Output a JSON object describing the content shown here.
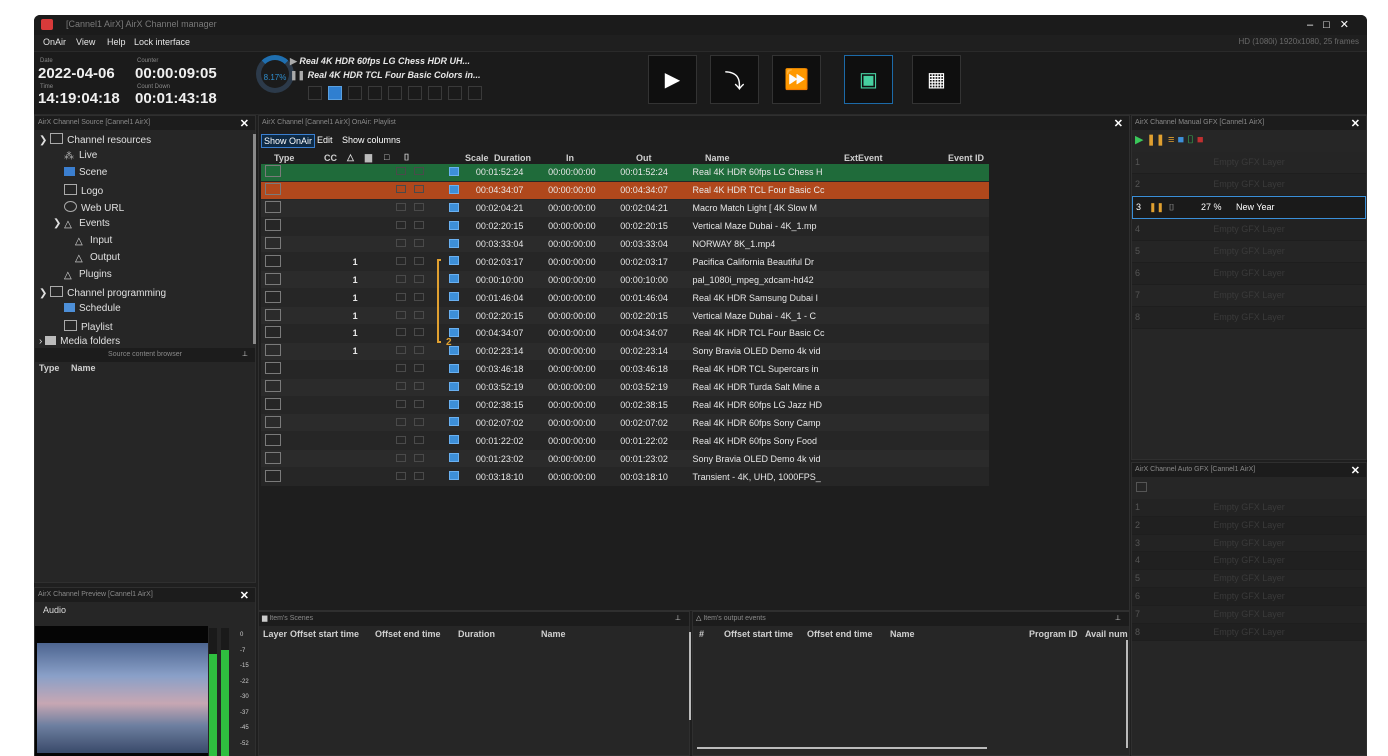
{
  "window": {
    "title": "[Cannel1 AirX] AirX Channel manager",
    "resolution": "HD (1080i) 1920x1080, 25 frames"
  },
  "menu": [
    "OnAir",
    "View",
    "Help",
    "Lock interface"
  ],
  "toolbar": {
    "date_label": "Date",
    "date": "2022-04-06",
    "counter_label": "Counter",
    "counter": "00:00:09:05",
    "time_label": "Time",
    "time": "14:19:04:18",
    "countdown_label": "Count Down",
    "countdown": "00:01:43:18",
    "progress_label": "8.17%",
    "progress": 8.17,
    "now_playing": "Real 4K HDR 60fps  LG Chess HDR UH...",
    "next_playing": "Real 4K HDR  TCL Four Basic Colors in..."
  },
  "source_panel": {
    "title": "AirX Channel Source [Cannel1 AirX]",
    "tree": [
      "Channel resources",
      "Live",
      "Scene",
      "Logo",
      "Web URL",
      "Events",
      "Input",
      "Output",
      "Plugins",
      "Channel programming",
      "Schedule",
      "Playlist",
      "Media folders"
    ],
    "browser_title": "Source content browser",
    "browser_cols": [
      "Type",
      "Name"
    ]
  },
  "preview_panel": {
    "title": "AirX Channel Preview [Cannel1 AirX]",
    "audio_label": "Audio",
    "meter_scale": [
      "0",
      "-7",
      "-15",
      "-22",
      "-30",
      "-37",
      "-45",
      "-52"
    ]
  },
  "playlist": {
    "title": "AirX Channel [Cannel1 AirX] OnAir: Playlist",
    "tabs": [
      "Show OnAir",
      "Edit",
      "Show columns"
    ],
    "headers": [
      "Type",
      "CC",
      "Scale",
      "Duration",
      "In",
      "Out",
      "Name",
      "ExtEvent",
      "Event ID"
    ],
    "rows": [
      {
        "num": "",
        "duration": "00:01:52:24",
        "in": "00:00:00:00",
        "out": "00:01:52:24",
        "name": "Real 4K HDR 60fps  LG Chess H"
      },
      {
        "num": "",
        "duration": "00:04:34:07",
        "in": "00:00:00:00",
        "out": "00:04:34:07",
        "name": "Real 4K HDR  TCL Four Basic Cc"
      },
      {
        "num": "",
        "duration": "00:02:04:21",
        "in": "00:00:00:00",
        "out": "00:02:04:21",
        "name": "Macro Match Light [ 4K Slow M"
      },
      {
        "num": "",
        "duration": "00:02:20:15",
        "in": "00:00:00:00",
        "out": "00:02:20:15",
        "name": "Vertical Maze Dubai - 4K_1.mp"
      },
      {
        "num": "",
        "duration": "00:03:33:04",
        "in": "00:00:00:00",
        "out": "00:03:33:04",
        "name": "NORWAY 8K_1.mp4"
      },
      {
        "num": "1",
        "duration": "00:02:03:17",
        "in": "00:00:00:00",
        "out": "00:02:03:17",
        "name": "Pacifica California Beautiful Dr"
      },
      {
        "num": "1",
        "duration": "00:00:10:00",
        "in": "00:00:00:00",
        "out": "00:00:10:00",
        "name": "pal_1080i_mpeg_xdcam-hd42"
      },
      {
        "num": "1",
        "duration": "00:01:46:04",
        "in": "00:00:00:00",
        "out": "00:01:46:04",
        "name": "Real 4K HDR  Samsung Dubai I"
      },
      {
        "num": "1",
        "duration": "00:02:20:15",
        "in": "00:00:00:00",
        "out": "00:02:20:15",
        "name": "Vertical Maze Dubai - 4K_1 - C"
      },
      {
        "num": "1",
        "duration": "00:04:34:07",
        "in": "00:00:00:00",
        "out": "00:04:34:07",
        "name": "Real 4K HDR  TCL Four Basic Cc"
      },
      {
        "num": "1",
        "duration": "00:02:23:14",
        "in": "00:00:00:00",
        "out": "00:02:23:14",
        "name": "Sony Bravia OLED Demo 4k vid"
      },
      {
        "num": "",
        "duration": "00:03:46:18",
        "in": "00:00:00:00",
        "out": "00:03:46:18",
        "name": "Real 4K HDR  TCL Supercars in"
      },
      {
        "num": "",
        "duration": "00:03:52:19",
        "in": "00:00:00:00",
        "out": "00:03:52:19",
        "name": "Real 4K HDR  Turda Salt Mine a"
      },
      {
        "num": "",
        "duration": "00:02:38:15",
        "in": "00:00:00:00",
        "out": "00:02:38:15",
        "name": "Real 4K HDR 60fps  LG Jazz HD"
      },
      {
        "num": "",
        "duration": "00:02:07:02",
        "in": "00:00:00:00",
        "out": "00:02:07:02",
        "name": "Real 4K HDR 60fps  Sony Camp"
      },
      {
        "num": "",
        "duration": "00:01:22:02",
        "in": "00:00:00:00",
        "out": "00:01:22:02",
        "name": "Real 4K HDR 60fps  Sony Food"
      },
      {
        "num": "",
        "duration": "00:01:23:02",
        "in": "00:00:00:00",
        "out": "00:01:23:02",
        "name": "Sony Bravia OLED Demo 4k vid"
      },
      {
        "num": "",
        "duration": "00:03:18:10",
        "in": "00:00:00:00",
        "out": "00:03:18:10",
        "name": "Transient - 4K, UHD, 1000FPS_"
      }
    ],
    "group_end_label": "2"
  },
  "scenes_panel": {
    "title": "Item's Scenes",
    "cols": [
      "Layer",
      "Offset start time",
      "Offset end time",
      "Duration",
      "Name"
    ]
  },
  "events_panel": {
    "title": "Item's output events",
    "cols": [
      "#",
      "Offset start time",
      "Offset end time",
      "Name",
      "Program ID",
      "Avail num"
    ]
  },
  "manual_gfx": {
    "title": "AirX Channel Manual GFX [Cannel1 AirX]",
    "rows": [
      {
        "num": "1",
        "text": "Empty GFX Layer"
      },
      {
        "num": "2",
        "text": "Empty GFX Layer"
      },
      {
        "num": "3",
        "text": "New Year",
        "pct": "27 %"
      },
      {
        "num": "4",
        "text": "Empty GFX Layer"
      },
      {
        "num": "5",
        "text": "Empty GFX Layer"
      },
      {
        "num": "6",
        "text": "Empty GFX Layer"
      },
      {
        "num": "7",
        "text": "Empty GFX Layer"
      },
      {
        "num": "8",
        "text": "Empty GFX Layer"
      }
    ]
  },
  "auto_gfx": {
    "title": "AirX Channel Auto GFX [Cannel1 AirX]",
    "rows": [
      {
        "num": "1",
        "text": "Empty GFX Layer"
      },
      {
        "num": "2",
        "text": "Empty GFX Layer"
      },
      {
        "num": "3",
        "text": "Empty GFX Layer"
      },
      {
        "num": "4",
        "text": "Empty GFX Layer"
      },
      {
        "num": "5",
        "text": "Empty GFX Layer"
      },
      {
        "num": "6",
        "text": "Empty GFX Layer"
      },
      {
        "num": "7",
        "text": "Empty GFX Layer"
      },
      {
        "num": "8",
        "text": "Empty GFX Layer"
      }
    ]
  },
  "colors": {
    "playing_row": "#1f6b3a",
    "next_row": "#b0481c",
    "accent": "#1f6fb0",
    "group_bracket": "#e0a030"
  }
}
